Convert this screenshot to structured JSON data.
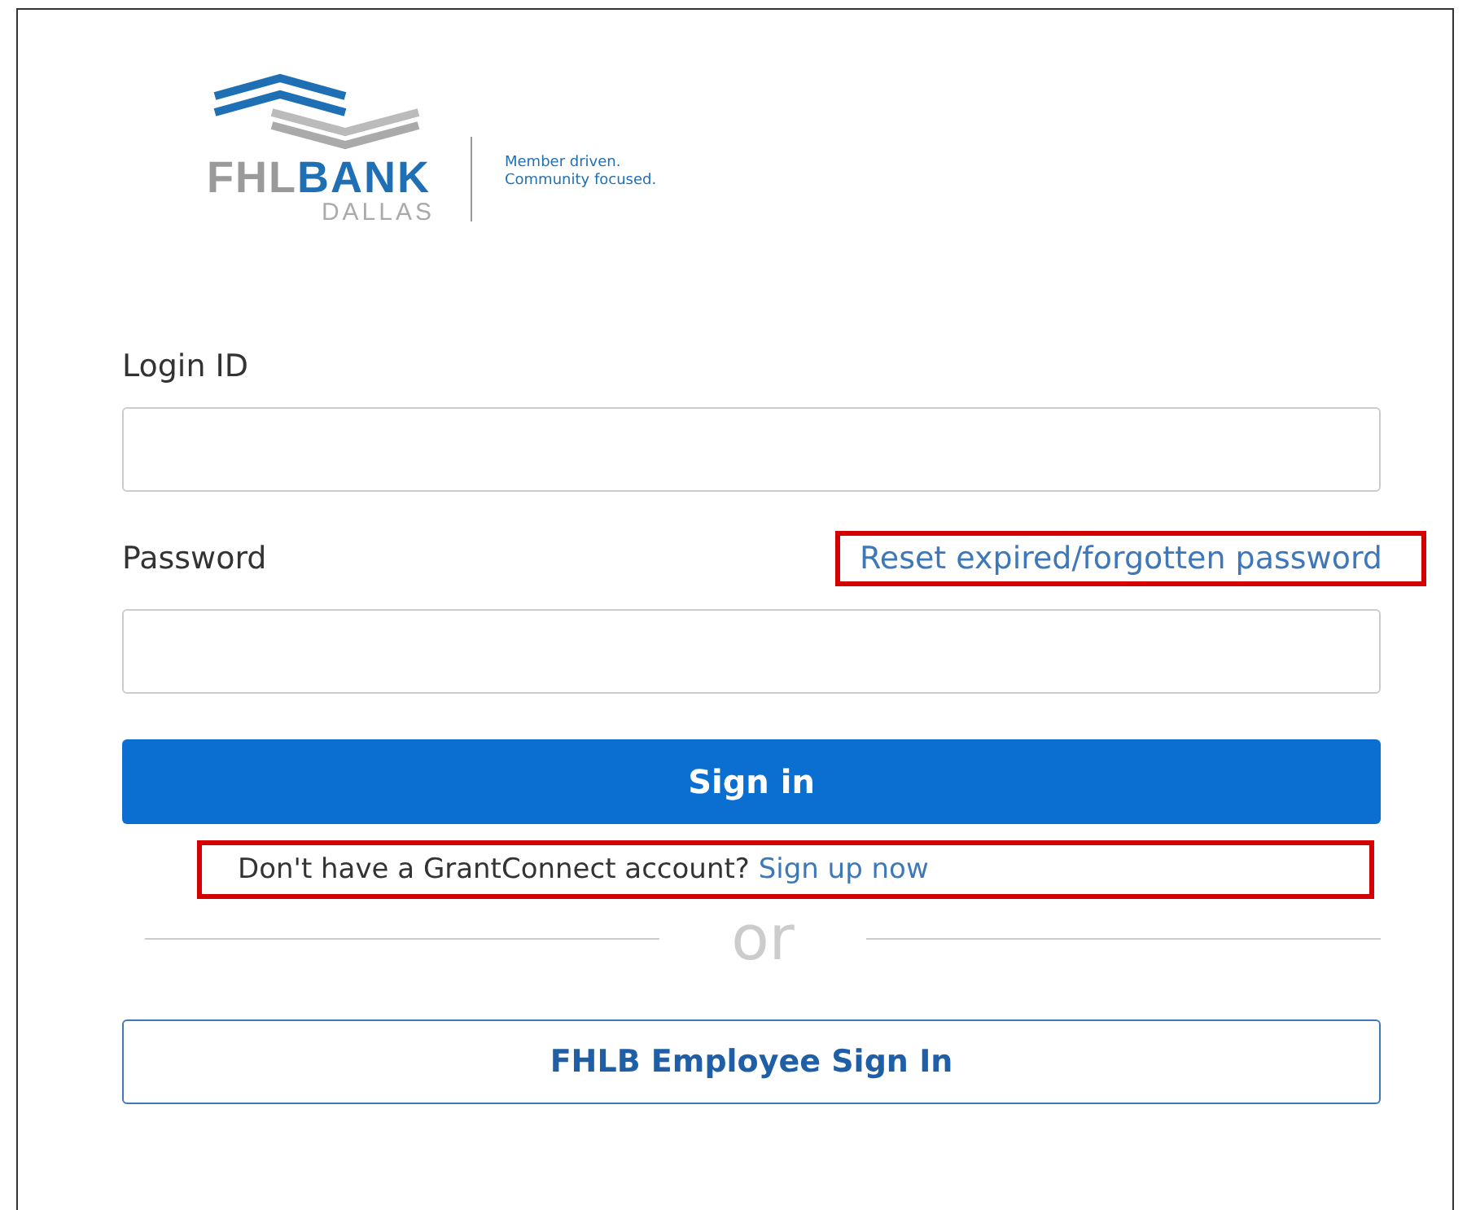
{
  "logo": {
    "brand_light": "FHL",
    "brand_bold": "BANK",
    "city": "DALLAS",
    "tagline": [
      "Member driven.",
      "Community focused."
    ]
  },
  "form": {
    "login_label": "Login ID",
    "password_label": "Password",
    "reset_link": "Reset expired/forgotten password",
    "sign_in_button": "Sign in",
    "signup_prompt": "Don't have a GrantConnect account?",
    "signup_link": "Sign up now",
    "divider_text": "or",
    "employee_button": "FHLB Employee Sign In"
  }
}
